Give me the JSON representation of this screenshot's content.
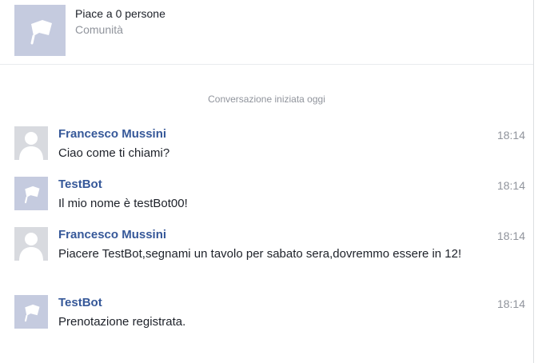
{
  "header": {
    "likes": "Piace a 0 persone",
    "category": "Comunità",
    "avatar_icon": "flag-icon"
  },
  "conversation": {
    "started_label": "Conversazione iniziata oggi",
    "messages": [
      {
        "sender": "Francesco Mussini",
        "text": "Ciao come ti chiami?",
        "time": "18:14",
        "avatar": "user-silhouette-icon"
      },
      {
        "sender": "TestBot",
        "text": "Il mio nome è testBot00!",
        "time": "18:14",
        "avatar": "flag-icon"
      },
      {
        "sender": "Francesco Mussini",
        "text": "Piacere TestBot,segnami un tavolo per sabato sera,dovremmo essere in 12!",
        "time": "18:14",
        "avatar": "user-silhouette-icon"
      },
      {
        "sender": "TestBot",
        "text": "Prenotazione registrata.",
        "time": "18:14",
        "avatar": "flag-icon"
      }
    ]
  },
  "colors": {
    "sender_name": "#365899",
    "muted_text": "#90949c",
    "page_avatar_bg": "#c5cbdf",
    "user_avatar_bg": "#d8dadf"
  }
}
